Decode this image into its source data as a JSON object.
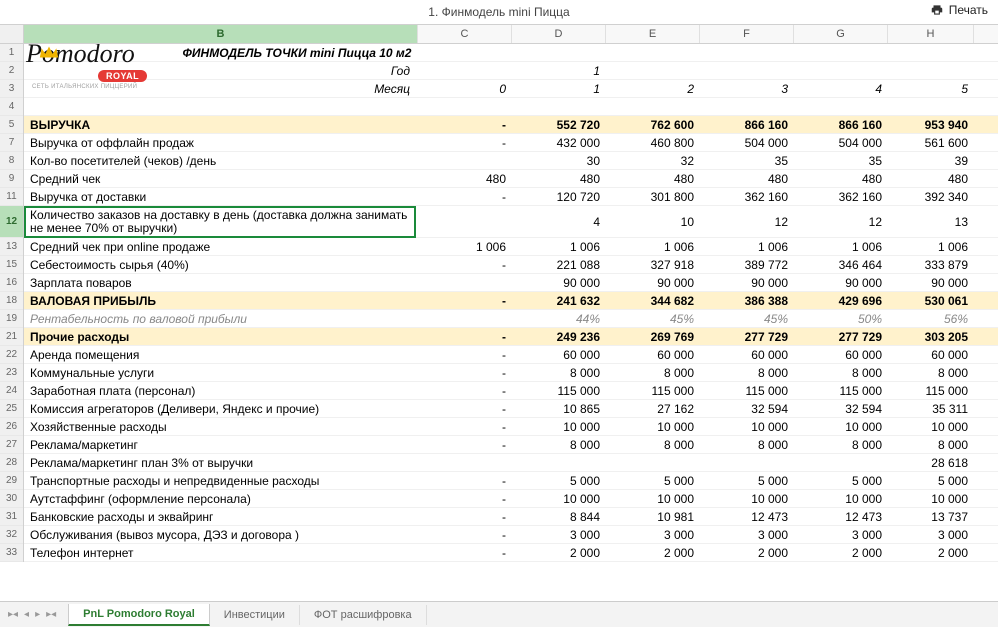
{
  "topbar": {
    "title": "1. Финмодель mini Пицца",
    "print": "Печать"
  },
  "columns": [
    "B",
    "C",
    "D",
    "E",
    "F",
    "G",
    "H"
  ],
  "tabs": {
    "active": "PnL Pomodoro Royal",
    "t2": "Инвестиции",
    "t3": "ФОТ расшифровка"
  },
  "logo": {
    "script": "Pomodoro",
    "royal": "ROYAL",
    "tag": "СЕТЬ ИТАЛЬЯНСКИХ ПИЦЦЕРИЙ"
  },
  "rows": [
    {
      "n": "1",
      "type": "title",
      "B": "ФИНМОДЕЛЬ ТОЧКИ mini Пицца 10 м2"
    },
    {
      "n": "2",
      "type": "subtitle",
      "B": "Год",
      "D": "1"
    },
    {
      "n": "3",
      "type": "months",
      "B": "Месяц",
      "C": "0",
      "D": "1",
      "E": "2",
      "F": "3",
      "G": "4",
      "H": "5"
    },
    {
      "n": "4",
      "type": "blank"
    },
    {
      "n": "5",
      "type": "hl",
      "bold": true,
      "B": "ВЫРУЧКА",
      "C": "-",
      "D": "552 720",
      "E": "762 600",
      "F": "866 160",
      "G": "866 160",
      "H": "953 940"
    },
    {
      "n": "7",
      "B": "Выручка от оффлайн продаж",
      "C": "-",
      "D": "432 000",
      "E": "460 800",
      "F": "504 000",
      "G": "504 000",
      "H": "561 600"
    },
    {
      "n": "8",
      "B": "Кол-во посетителей (чеков) /день",
      "D": "30",
      "E": "32",
      "F": "35",
      "G": "35",
      "H": "39"
    },
    {
      "n": "9",
      "B": "Средний чек",
      "C": "480",
      "D": "480",
      "E": "480",
      "F": "480",
      "G": "480",
      "H": "480"
    },
    {
      "n": "11",
      "B": "Выручка от доставки",
      "C": "-",
      "D": "120 720",
      "E": "301 800",
      "F": "362 160",
      "G": "362 160",
      "H": "392 340"
    },
    {
      "n": "12",
      "type": "tall",
      "sel": true,
      "B": "Количество заказов на доставку в день (доставка должна занимать не менее 70% от выручки)",
      "D": "4",
      "E": "10",
      "F": "12",
      "G": "12",
      "H": "13"
    },
    {
      "n": "13",
      "B": "Средний чек при online продаже",
      "C": "1 006",
      "D": "1 006",
      "E": "1 006",
      "F": "1 006",
      "G": "1 006",
      "H": "1 006"
    },
    {
      "n": "15",
      "B": "Себестоимость сырья (40%)",
      "C": "-",
      "D": "221 088",
      "E": "327 918",
      "F": "389 772",
      "G": "346 464",
      "H": "333 879"
    },
    {
      "n": "16",
      "B": "Зарплата поваров",
      "D": "90 000",
      "E": "90 000",
      "F": "90 000",
      "G": "90 000",
      "H": "90 000"
    },
    {
      "n": "18",
      "type": "hl",
      "bold": true,
      "B": "ВАЛОВАЯ ПРИБЫЛЬ",
      "C": "-",
      "D": "241 632",
      "E": "344 682",
      "F": "386 388",
      "G": "429 696",
      "H": "530 061"
    },
    {
      "n": "19",
      "type": "ital",
      "B": "Рентабельность по валовой прибыли",
      "D": "44%",
      "E": "45%",
      "F": "45%",
      "G": "50%",
      "H": "56%"
    },
    {
      "n": "21",
      "type": "hl",
      "bold": true,
      "B": "Прочие расходы",
      "C": "-",
      "D": "249 236",
      "E": "269 769",
      "F": "277 729",
      "G": "277 729",
      "H": "303 205"
    },
    {
      "n": "22",
      "B": "Аренда помещения",
      "C": "-",
      "D": "60 000",
      "E": "60 000",
      "F": "60 000",
      "G": "60 000",
      "H": "60 000"
    },
    {
      "n": "23",
      "B": "Коммунальные услуги",
      "C": "-",
      "D": "8 000",
      "E": "8 000",
      "F": "8 000",
      "G": "8 000",
      "H": "8 000"
    },
    {
      "n": "24",
      "B": "Заработная плата (персонал)",
      "C": "-",
      "D": "115 000",
      "E": "115 000",
      "F": "115 000",
      "G": "115 000",
      "H": "115 000"
    },
    {
      "n": "25",
      "B": "Комиссия агрегаторов (Деливери, Яндекс и прочие)",
      "C": "-",
      "D": "10 865",
      "E": "27 162",
      "F": "32 594",
      "G": "32 594",
      "H": "35 311"
    },
    {
      "n": "26",
      "B": "Хозяйственные расходы",
      "C": "-",
      "D": "10 000",
      "E": "10 000",
      "F": "10 000",
      "G": "10 000",
      "H": "10 000"
    },
    {
      "n": "27",
      "B": "Реклама/маркетинг",
      "C": "-",
      "D": "8 000",
      "E": "8 000",
      "F": "8 000",
      "G": "8 000",
      "H": "8 000"
    },
    {
      "n": "28",
      "B": "Реклама/маркетинг план 3% от выручки",
      "H": "28 618"
    },
    {
      "n": "29",
      "B": "Транспортные расходы и непредвиденные расходы",
      "C": "-",
      "D": "5 000",
      "E": "5 000",
      "F": "5 000",
      "G": "5 000",
      "H": "5 000"
    },
    {
      "n": "30",
      "B": "Аутстаффинг (оформление персонала)",
      "C": "-",
      "D": "10 000",
      "E": "10 000",
      "F": "10 000",
      "G": "10 000",
      "H": "10 000"
    },
    {
      "n": "31",
      "B": "Банковские расходы и эквайринг",
      "C": "-",
      "D": "8 844",
      "E": "10 981",
      "F": "12 473",
      "G": "12 473",
      "H": "13 737"
    },
    {
      "n": "32",
      "B": "Обслуживания (вывоз мусора,  ДЭЗ и  договора )",
      "C": "-",
      "D": "3 000",
      "E": "3 000",
      "F": "3 000",
      "G": "3 000",
      "H": "3 000"
    },
    {
      "n": "33",
      "B": "Телефон  интернет",
      "C": "-",
      "D": "2 000",
      "E": "2 000",
      "F": "2 000",
      "G": "2 000",
      "H": "2 000"
    }
  ]
}
